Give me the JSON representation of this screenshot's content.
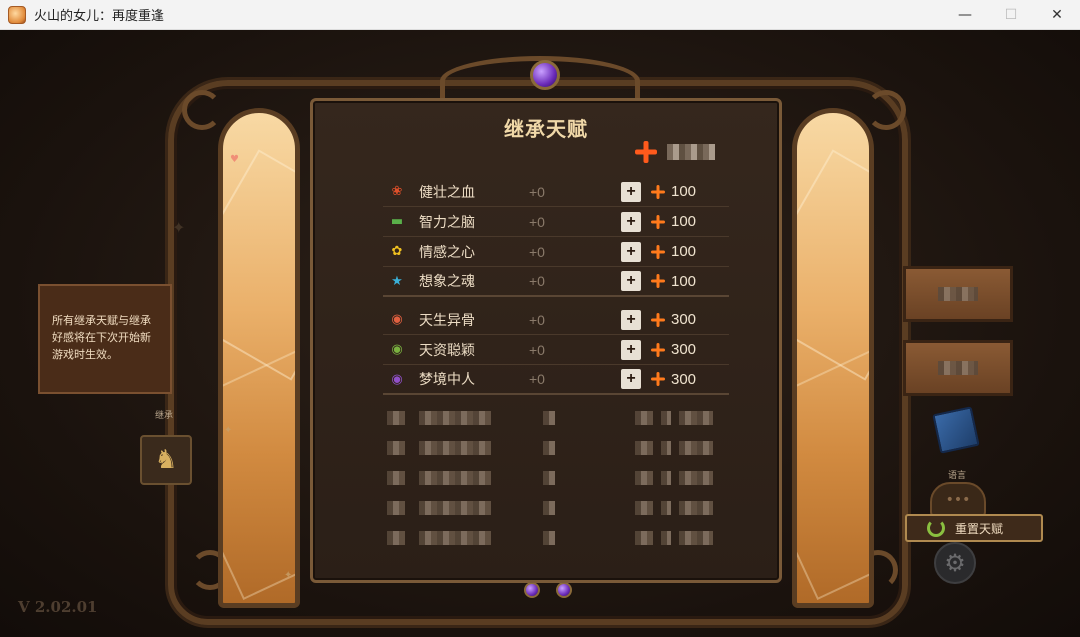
{
  "window": {
    "title": "火山的女儿：再度重逢",
    "minimize": "—",
    "maximize": "☐",
    "close": "✕"
  },
  "panel": {
    "title": "继承天赋",
    "currency_icon": "spark-icon"
  },
  "talents": [
    {
      "label": "健壮之血",
      "bonus": "+0",
      "cost": "100",
      "icon": "paw-icon",
      "color": "#e0502a"
    },
    {
      "label": "智力之脑",
      "bonus": "+0",
      "cost": "100",
      "icon": "book-icon",
      "color": "#5ab04a"
    },
    {
      "label": "情感之心",
      "bonus": "+0",
      "cost": "100",
      "icon": "flower-icon",
      "color": "#f0c020"
    },
    {
      "label": "想象之魂",
      "bonus": "+0",
      "cost": "100",
      "icon": "star-icon",
      "color": "#3ab0d8"
    },
    {
      "label": "天生异骨",
      "bonus": "+0",
      "cost": "300",
      "icon": "bone-badge-icon",
      "color": "#e06040"
    },
    {
      "label": "天资聪颖",
      "bonus": "+0",
      "cost": "300",
      "icon": "leaf-badge-icon",
      "color": "#7ab040"
    },
    {
      "label": "梦境中人",
      "bonus": "+0",
      "cost": "300",
      "icon": "rose-badge-icon",
      "color": "#9050c8"
    }
  ],
  "info_box": {
    "text": "所有继承天赋与继承好感将在下次开始新游戏时生效。"
  },
  "inherit": {
    "label": "继承"
  },
  "language": {
    "label": "语言"
  },
  "reset_button": {
    "label": "重置天赋"
  },
  "version": "V 2.02.01"
}
